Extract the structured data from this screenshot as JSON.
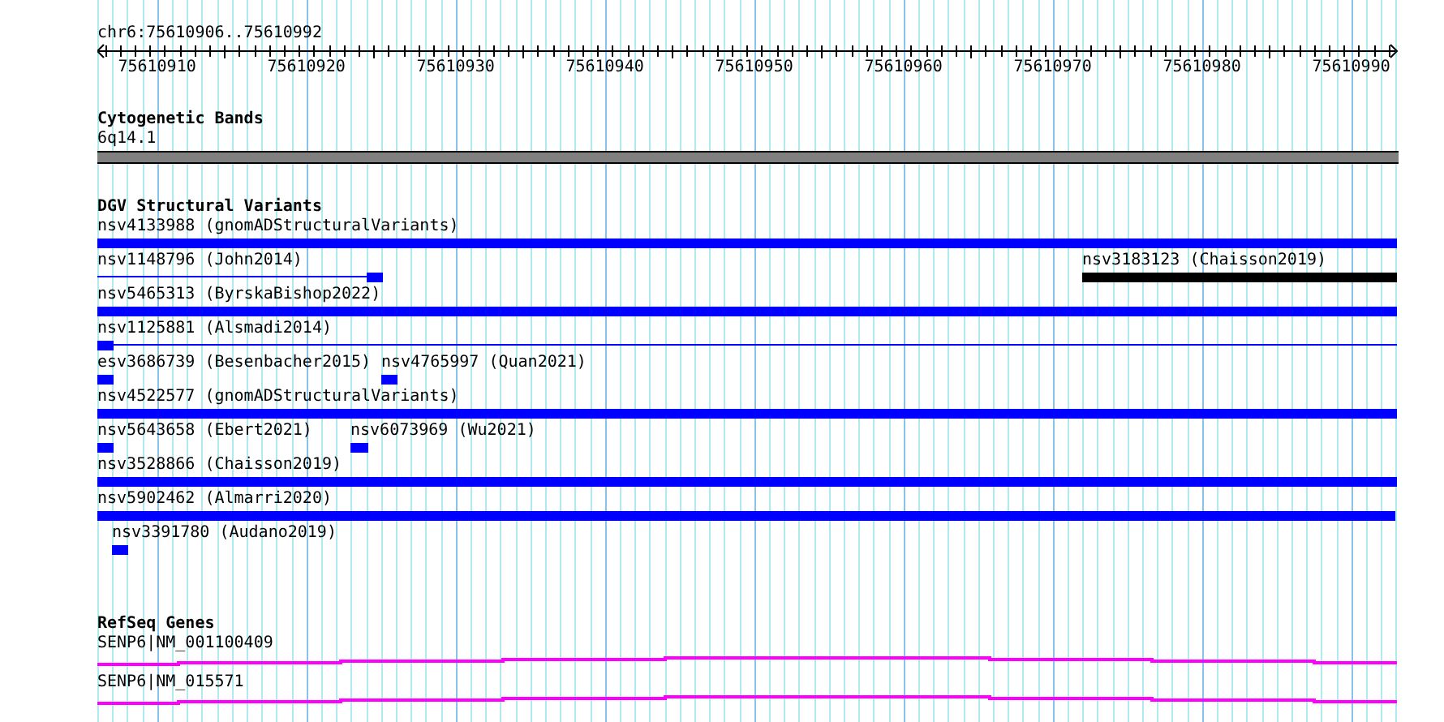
{
  "location": "chr6:75610906..75610992",
  "ruler": {
    "labels": [
      "75610910",
      "75610920",
      "75610930",
      "75610940",
      "75610950",
      "75610960",
      "75610970",
      "75610980",
      "75610990"
    ]
  },
  "tracks": [
    {
      "kind": "bands",
      "title": "Cytogenetic Bands",
      "features": [
        {
          "label": "6q14.1"
        }
      ]
    },
    {
      "kind": "variants",
      "title": "DGV Structural Variants",
      "rows": [
        {
          "features": [
            {
              "label": "nsv4133988 (gnomADStructuralVariants)",
              "kind": "bar",
              "color": "#0000ff"
            }
          ]
        },
        {
          "features": [
            {
              "label": "nsv1148796 (John2014)",
              "kind": "line_block",
              "color": "#0000ff"
            },
            {
              "label": "nsv3183123 (Chaisson2019)",
              "kind": "bar",
              "color": "#000000"
            }
          ]
        },
        {
          "features": [
            {
              "label": "nsv5465313 (ByrskaBishop2022)",
              "kind": "bar",
              "color": "#0000ff"
            }
          ]
        },
        {
          "features": [
            {
              "label": "nsv1125881 (Alsmadi2014)",
              "kind": "line_block",
              "color": "#0000ff"
            }
          ]
        },
        {
          "features": [
            {
              "label": "esv3686739 (Besenbacher2015)",
              "kind": "block",
              "color": "#0000ff"
            },
            {
              "label": "nsv4765997 (Quan2021)",
              "kind": "block",
              "color": "#0000ff"
            }
          ]
        },
        {
          "features": [
            {
              "label": "nsv4522577 (gnomADStructuralVariants)",
              "kind": "bar",
              "color": "#0000ff"
            }
          ]
        },
        {
          "features": [
            {
              "label": "nsv5643658 (Ebert2021)",
              "kind": "block",
              "color": "#0000ff"
            },
            {
              "label": "nsv6073969 (Wu2021)",
              "kind": "block",
              "color": "#0000ff"
            }
          ]
        },
        {
          "features": [
            {
              "label": "nsv3528866 (Chaisson2019)",
              "kind": "bar",
              "color": "#0000ff"
            }
          ]
        },
        {
          "features": [
            {
              "label": "nsv5902462 (Almarri2020)",
              "kind": "bar",
              "color": "#0000ff"
            }
          ]
        },
        {
          "features": [
            {
              "label": "nsv3391780 (Audano2019)",
              "kind": "block",
              "color": "#0000ff"
            }
          ]
        }
      ]
    },
    {
      "kind": "genes",
      "title": "RefSeq Genes",
      "features": [
        {
          "label": "SENP6|NM_001100409",
          "kind": "transcript"
        },
        {
          "label": "SENP6|NM_015571",
          "kind": "transcript"
        }
      ]
    }
  ]
}
